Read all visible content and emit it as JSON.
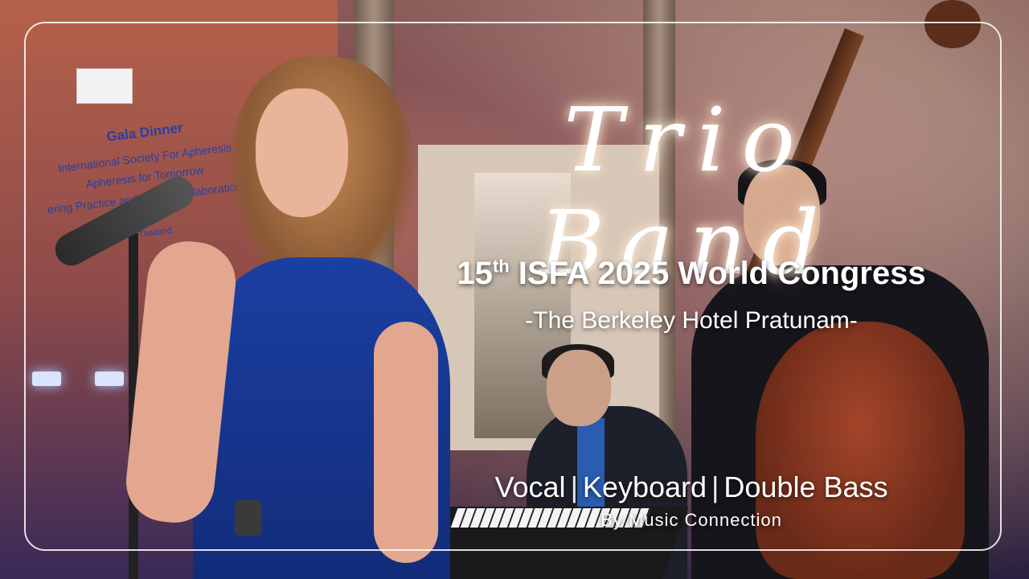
{
  "photo": {
    "description_icon": "band-performance-photo"
  },
  "banner": {
    "title": "Gala Dinner",
    "line1": "International Society For Apheresis",
    "line2": "Apheresis for Tomorrow",
    "line3": "ering Practice and Global Collaboration",
    "line4": "gkok Thailand"
  },
  "overlay": {
    "title": "Trio Band",
    "congress_number": "15",
    "congress_suffix": "th",
    "congress_name": "ISFA 2025 World Congress",
    "venue": "-The Berkeley Hotel Pratunam-",
    "instrument_1": "Vocal",
    "instrument_2": "Keyboard",
    "instrument_3": "Double Bass",
    "separator": "|",
    "credit": "By Music Connection"
  },
  "colors": {
    "text": "#ffffff",
    "dress": "#1b3fa2",
    "bass": "#a4452a"
  }
}
